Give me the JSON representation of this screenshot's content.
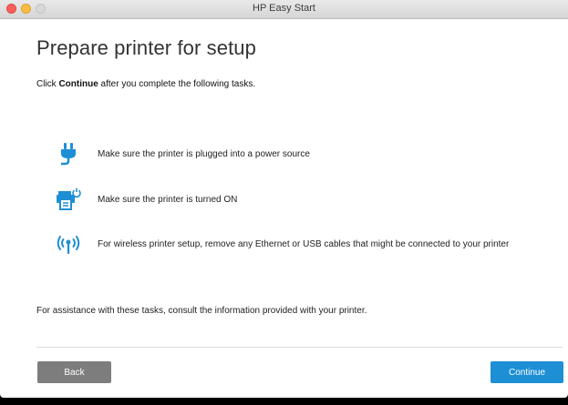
{
  "window": {
    "title": "HP Easy Start"
  },
  "page": {
    "title": "Prepare printer for setup",
    "instruction_prefix": "Click ",
    "instruction_bold": "Continue",
    "instruction_suffix": " after you complete the following tasks."
  },
  "tasks": [
    {
      "icon": "power-plug-icon",
      "text": "Make sure the printer is plugged into a power source"
    },
    {
      "icon": "printer-power-icon",
      "text": "Make sure the printer is turned ON"
    },
    {
      "icon": "wireless-icon",
      "text": "For wireless printer setup, remove any Ethernet or USB cables that might be connected to your printer"
    }
  ],
  "assistance_text": "For assistance with these tasks, consult the information provided with your printer.",
  "buttons": {
    "back": "Back",
    "continue": "Continue"
  },
  "colors": {
    "accent": "#1e8fd5",
    "back_button": "#7d7d7d"
  }
}
